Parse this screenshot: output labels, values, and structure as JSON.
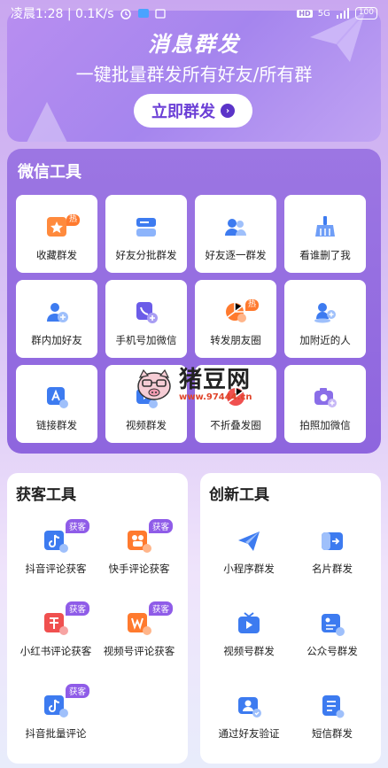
{
  "status_bar": {
    "time": "凌晨1:28 | 0.1K/s",
    "net": "5G",
    "battery": "100",
    "hd": "HD"
  },
  "banner": {
    "title": "消息群发",
    "subtitle": "一键批量群发所有好友/所有群",
    "button": "立即群发"
  },
  "wechat_tools": {
    "title": "微信工具",
    "items": [
      {
        "label": "收藏群发",
        "icon": "star-bookmark-icon",
        "hot": "热"
      },
      {
        "label": "好友分批群发",
        "icon": "batch-card-icon"
      },
      {
        "label": "好友逐一群发",
        "icon": "friends-icon"
      },
      {
        "label": "看谁删了我",
        "icon": "broom-icon"
      },
      {
        "label": "群内加好友",
        "icon": "add-person-icon"
      },
      {
        "label": "手机号加微信",
        "icon": "phone-add-icon"
      },
      {
        "label": "转发朋友圈",
        "icon": "moments-icon",
        "hot": "热"
      },
      {
        "label": "加附近的人",
        "icon": "nearby-person-icon"
      },
      {
        "label": "链接群发",
        "icon": "link-icon"
      },
      {
        "label": "视频群发",
        "icon": "video-icon"
      },
      {
        "label": "不折叠发圈",
        "icon": "unfold-moments-icon"
      },
      {
        "label": "拍照加微信",
        "icon": "camera-add-icon"
      }
    ]
  },
  "watermark": {
    "brand": "猪豆网",
    "url": "www.97444.cn"
  },
  "acquire_tools": {
    "title": "获客工具",
    "tag": "获客",
    "items": [
      {
        "label": "抖音评论获客",
        "icon": "douyin-icon"
      },
      {
        "label": "快手评论获客",
        "icon": "kuaishou-icon"
      },
      {
        "label": "小红书评论获客",
        "icon": "xiaohongshu-icon"
      },
      {
        "label": "视频号评论获客",
        "icon": "channels-icon"
      },
      {
        "label": "抖音批量评论",
        "icon": "douyin-batch-icon"
      }
    ]
  },
  "innovate_tools": {
    "title": "创新工具",
    "items": [
      {
        "label": "小程序群发",
        "icon": "paper-plane-icon"
      },
      {
        "label": "名片群发",
        "icon": "card-share-icon"
      },
      {
        "label": "视频号群发",
        "icon": "tv-play-icon"
      },
      {
        "label": "公众号群发",
        "icon": "official-account-icon"
      },
      {
        "label": "通过好友验证",
        "icon": "verify-friend-icon"
      },
      {
        "label": "短信群发",
        "icon": "sms-icon"
      }
    ]
  },
  "colors": {
    "accent": "#8f5ce8",
    "icon_blue": "#3d7bf0",
    "icon_orange": "#ff7a2e",
    "icon_red": "#f0504f"
  }
}
